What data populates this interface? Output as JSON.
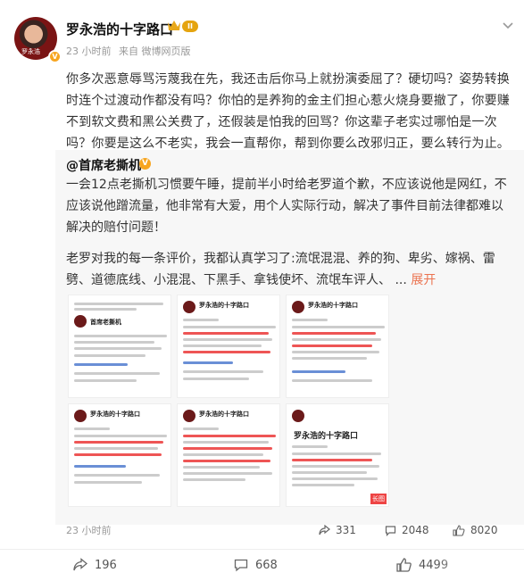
{
  "author": {
    "name": "罗永浩的十字路口",
    "avatar_tag": "罗永浩",
    "lv": "II",
    "time": "23 小时前",
    "source": "来自 微博网页版"
  },
  "post": {
    "text": "你多次恶意辱骂污蔑我在先，我还击后你马上就扮演委屈了？硬切吗？姿势转换时连个过渡动作都没有吗？你怕的是养狗的金主们担心惹火烧身要撤了，你要赚不到软文费和黑公关费了，还假装是怕我的回骂？你这辈子老实过哪怕是一次吗？你要是这么不老实，我会一直帮你，帮到你要么改邪归正，要么转行为止。"
  },
  "repost": {
    "author": "@首席老撕机",
    "text1": "一会12点老撕机习惯要午睡，提前半小时给老罗道个歉，不应该说他是网红，不应该说他蹭流量，他非常有大爱，用个人实际行动，解决了事件目前法律都难以解决的赔付问题！",
    "text2": "老罗对我的每一条评价，我都认真学习了:流氓混混、养的狗、卑劣、嫁祸、雷劈、道德底线、小混混、下黑手、拿钱使坏、流氓车评人、 ... ",
    "expand": "展开",
    "time": "23 小时前",
    "share_count": "331",
    "comment_count": "2048",
    "like_count": "8020",
    "thumbs": [
      {
        "name": "首席老撕机"
      },
      {
        "name": "罗永浩的十字路口"
      },
      {
        "name": "罗永浩的十字路口"
      },
      {
        "name": "罗永浩的十字路口"
      },
      {
        "name": "罗永浩的十字路口"
      },
      {
        "name": "罗永浩的十字路口"
      }
    ],
    "long_tag": "长图"
  },
  "actions": {
    "share_count": "196",
    "comment_count": "668",
    "like_count": "4499"
  },
  "colors": {
    "accent": "#eb7350",
    "badge": "#f7a520"
  }
}
